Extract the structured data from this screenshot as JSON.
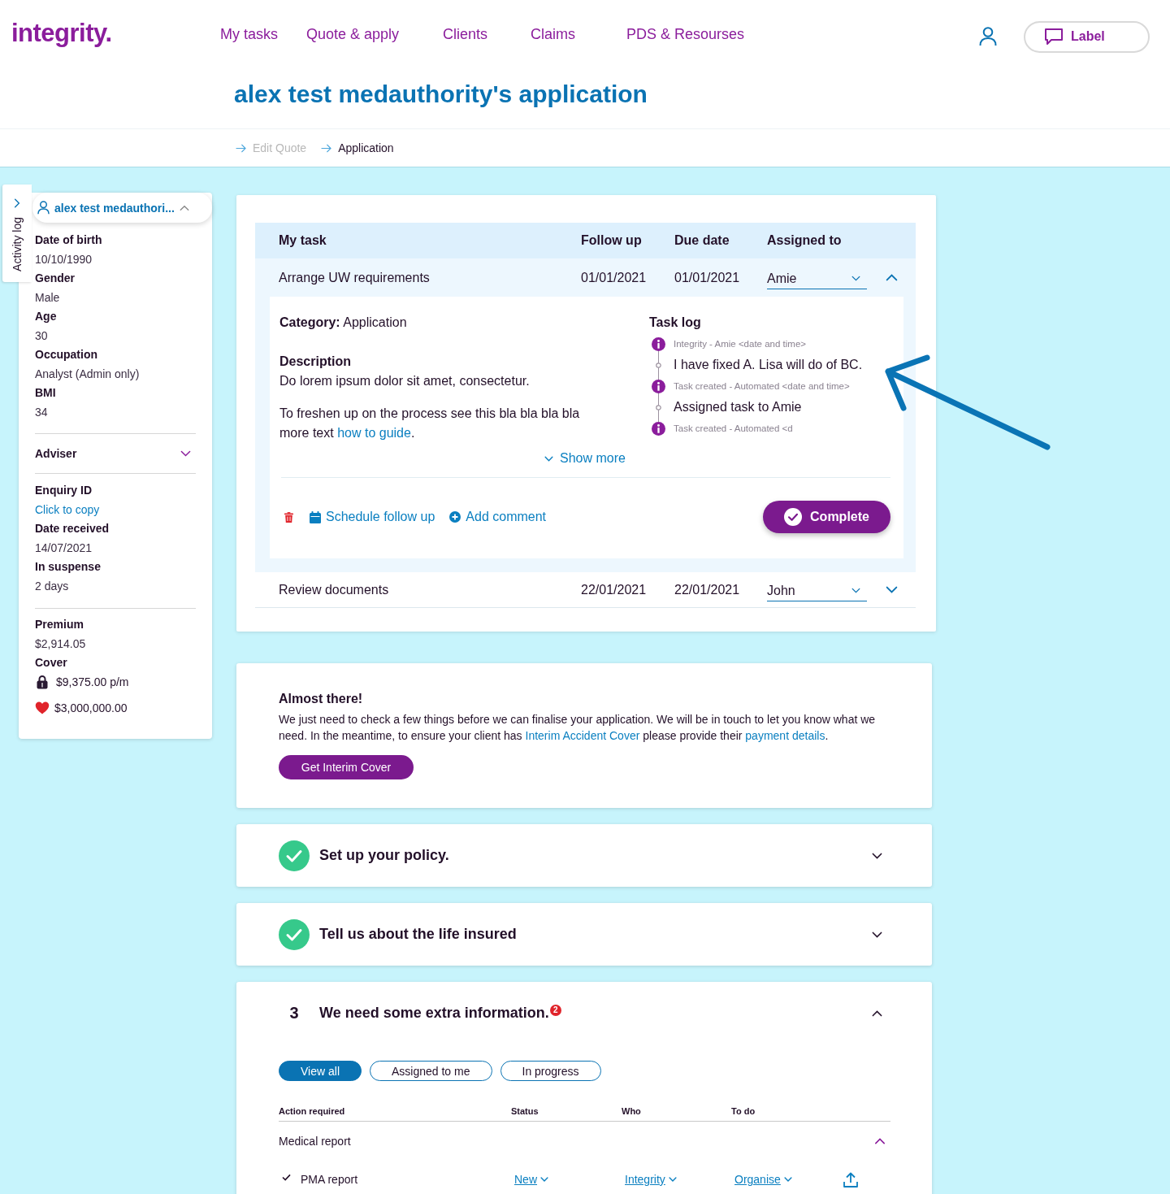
{
  "header": {
    "logo": "integrity.",
    "nav": [
      "My tasks",
      "Quote & apply",
      "Clients",
      "Claims",
      "PDS & Resourses"
    ],
    "label_button": "Label"
  },
  "page_title": "alex test medauthority's application",
  "breadcrumb": [
    {
      "label": "Edit Quote",
      "disabled": true
    },
    {
      "label": "Application",
      "disabled": false
    }
  ],
  "sidebar": {
    "activity_tab": "Activity log",
    "client": {
      "name": "alex test medauthori...",
      "expanded": true,
      "details": [
        {
          "label": "Date of birth",
          "value": "10/10/1990"
        },
        {
          "label": "Gender",
          "value": "Male"
        },
        {
          "label": "Age",
          "value": "30"
        },
        {
          "label": "Occupation",
          "value": "Analyst (Admin only)"
        },
        {
          "label": "BMI",
          "value": "34"
        }
      ],
      "adviser": {
        "label": "Adviser",
        "expanded": false
      },
      "enquiry": [
        {
          "label": "Enquiry ID",
          "value": "Click to copy",
          "kind": "link"
        },
        {
          "label": "Date received",
          "value": "14/07/2021",
          "kind": "text"
        },
        {
          "label": "In suspense",
          "value": "2 days",
          "kind": "text"
        }
      ],
      "premium": {
        "label": "Premium",
        "value": "$2,914.05"
      },
      "cover": {
        "label": "Cover",
        "items": [
          {
            "kind": "lock",
            "value": "$9,375.00 p/m"
          },
          {
            "kind": "heart",
            "value": "$3,000,000.00"
          }
        ]
      }
    }
  },
  "tasks": {
    "columns": [
      "My task",
      "Follow up",
      "Due date",
      "Assigned to"
    ],
    "rows": [
      {
        "task": "Arrange UW requirements",
        "follow_up": "01/01/2021",
        "due_date": "01/01/2021",
        "assigned_to": "Amie",
        "expanded": true,
        "details": {
          "category": "**Category:** Application",
          "description_heading": "Description",
          "description": "Do lorem ipsum dolor sit amet, consectetur.",
          "guide": {
            "text": "To freshen up on the process see this bla bla bla bla  more text ",
            "link": "how to guide",
            "after": "."
          },
          "task_log_heading": "Task log",
          "task_log": [
            {
              "meta": "Integrity - Amie <date and time>",
              "message": "I have fixed A. Lisa will do of BC."
            },
            {
              "meta": "Task created - Automated <date and time>",
              "message": "Assigned task to Amie"
            },
            {
              "meta": "Task created - Automated <d"
            }
          ],
          "show_more": "Show more",
          "actions": [
            {
              "kind": "delete"
            },
            {
              "kind": "schedule",
              "label": "Schedule follow up"
            },
            {
              "kind": "comment",
              "label": "Add comment"
            }
          ],
          "complete_button": "Complete"
        }
      },
      {
        "task": "Review documents",
        "follow_up": "22/01/2021",
        "due_date": "22/01/2021",
        "assigned_to": "John",
        "expanded": false
      }
    ]
  },
  "notice": {
    "title": "Almost there!",
    "body": [
      {
        "kind": "text",
        "text": "We just need to check a few things before we can finalise your application. We will be in touch to let you know what we need. In the meantime, to ensure your client has "
      },
      {
        "kind": "link",
        "text": "Interim Accident Cover"
      },
      {
        "kind": "text",
        "text": " please provide their "
      },
      {
        "kind": "link",
        "text": "payment details"
      },
      {
        "kind": "text",
        "text": "."
      }
    ],
    "button": "Get Interim Cover"
  },
  "steps": [
    {
      "title": "Set up your policy.",
      "complete": true,
      "expanded": false
    },
    {
      "title": "Tell us about the life insured",
      "complete": true,
      "expanded": false
    },
    {
      "number": "3",
      "title": "We need some extra information.",
      "badge": "2",
      "complete": false,
      "expanded": true,
      "filters": [
        {
          "label": "View all",
          "selected": true
        },
        {
          "label": "Assigned to me",
          "selected": false
        },
        {
          "label": "In progress",
          "selected": false
        }
      ],
      "requirements": {
        "columns": [
          "Action required",
          "Status",
          "Who",
          "To do"
        ],
        "groups": [
          {
            "name": "Medical report",
            "expanded": true,
            "items": [
              {
                "name": "PMA report",
                "checked": true,
                "status": "New",
                "who": "Integrity",
                "to_do": "Organise"
              }
            ]
          }
        ]
      }
    }
  ]
}
